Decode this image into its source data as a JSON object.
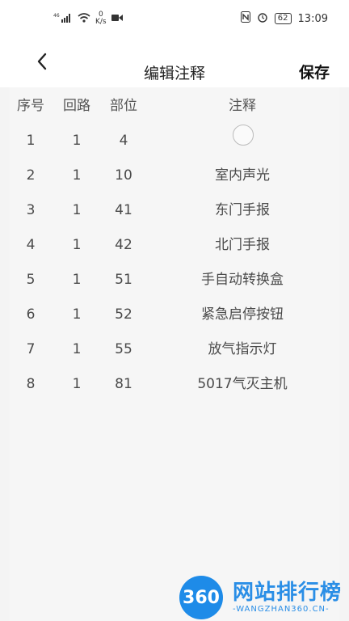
{
  "status": {
    "signal": "46",
    "net_speed_value": "0",
    "net_speed_unit": "K/s",
    "battery": "62",
    "time": "13:09"
  },
  "header": {
    "title": "编辑注释",
    "save_label": "保存"
  },
  "table": {
    "columns": [
      "序号",
      "回路",
      "部位",
      "注释"
    ],
    "rows": [
      {
        "seq": "1",
        "loop": "1",
        "part": "4",
        "note": ""
      },
      {
        "seq": "2",
        "loop": "1",
        "part": "10",
        "note": "室内声光"
      },
      {
        "seq": "3",
        "loop": "1",
        "part": "41",
        "note": "东门手报"
      },
      {
        "seq": "4",
        "loop": "1",
        "part": "42",
        "note": "北门手报"
      },
      {
        "seq": "5",
        "loop": "1",
        "part": "51",
        "note": "手自动转换盒"
      },
      {
        "seq": "6",
        "loop": "1",
        "part": "52",
        "note": "紧急启停按钮"
      },
      {
        "seq": "7",
        "loop": "1",
        "part": "55",
        "note": "放气指示灯"
      },
      {
        "seq": "8",
        "loop": "1",
        "part": "81",
        "note": "5017气灭主机"
      }
    ]
  },
  "watermark": {
    "badge": "360",
    "title": "网站排行榜",
    "subtitle": "-WANGZHAN360.CN-"
  }
}
